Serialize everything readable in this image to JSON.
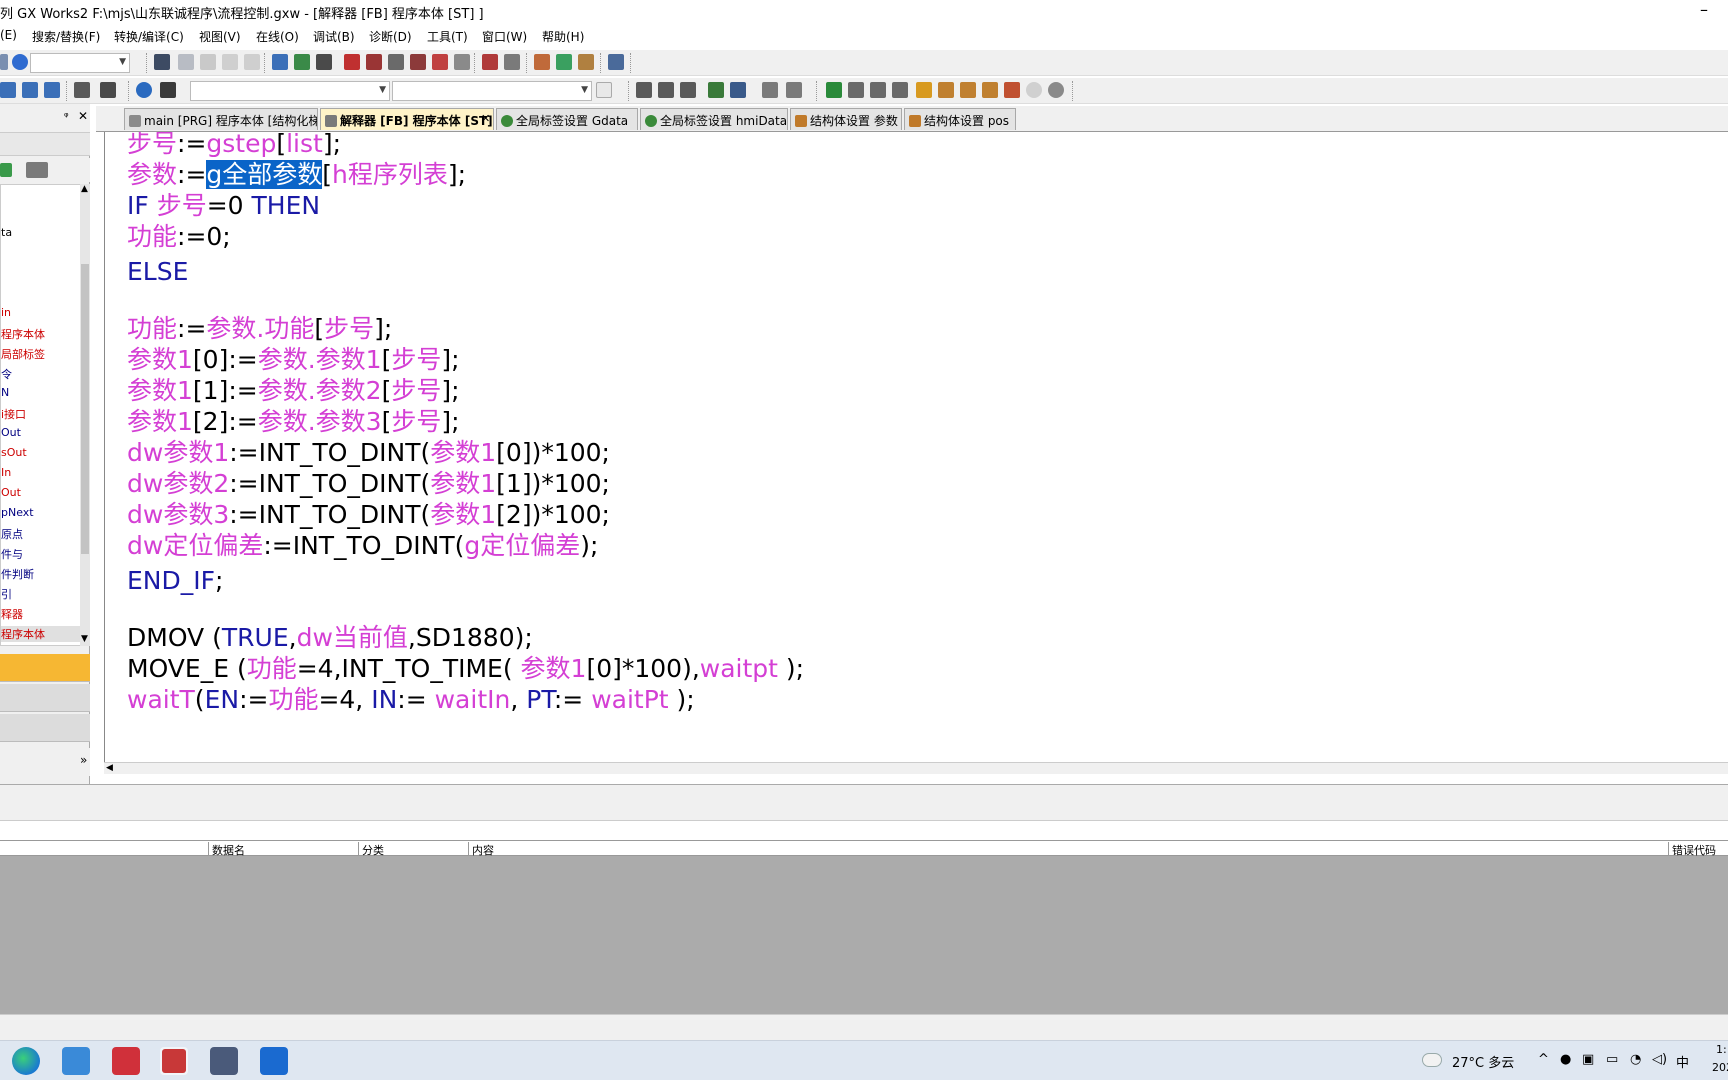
{
  "window": {
    "title": "列 GX Works2 F:\\mjs\\山东联诚程序\\流程控制.gxw - [解释器 [FB] 程序本体 [ST] ]",
    "minimize_glyph": "–"
  },
  "menu": [
    {
      "label": "(E)"
    },
    {
      "label": "搜索/替换(F)"
    },
    {
      "label": "转换/编译(C)"
    },
    {
      "label": "视图(V)"
    },
    {
      "label": "在线(O)"
    },
    {
      "label": "调试(B)"
    },
    {
      "label": "诊断(D)"
    },
    {
      "label": "工具(T)"
    },
    {
      "label": "窗口(W)"
    },
    {
      "label": "帮助(H)"
    }
  ],
  "nav": {
    "pin_glyph": "ᵠ",
    "close_glyph": "✕",
    "tree": [
      {
        "label": "ta",
        "color": "#000000"
      },
      {
        "label": "in",
        "color": "#cc0000"
      },
      {
        "label": "程序本体",
        "color": "#cc0000"
      },
      {
        "label": "局部标签",
        "color": "#cc0000"
      },
      {
        "label": "令",
        "color": "#000080"
      },
      {
        "label": "N",
        "color": "#000080"
      },
      {
        "label": "i接口",
        "color": "#cc0000"
      },
      {
        "label": "Out",
        "color": "#000080"
      },
      {
        "label": "sOut",
        "color": "#cc0000"
      },
      {
        "label": "In",
        "color": "#cc0000"
      },
      {
        "label": "Out",
        "color": "#cc0000"
      },
      {
        "label": "pNext",
        "color": "#000080"
      },
      {
        "label": "原点",
        "color": "#000080"
      },
      {
        "label": "件与",
        "color": "#000080"
      },
      {
        "label": "件判断",
        "color": "#000080"
      },
      {
        "label": "引",
        "color": "#000080"
      },
      {
        "label": "释器",
        "color": "#cc0000"
      },
      {
        "label": "程序本体",
        "color": "#cc0000"
      }
    ],
    "expand_glyph": "»"
  },
  "tabs": [
    {
      "label": "main [PRG] 程序本体 [结构化梯...",
      "active": false
    },
    {
      "label": "解释器 [FB] 程序本体 [ST]",
      "active": true
    },
    {
      "label": "全局标签设置 Gdata",
      "active": false
    },
    {
      "label": "全局标签设置 hmiData",
      "active": false
    },
    {
      "label": "结构体设置 参数",
      "active": false
    },
    {
      "label": "结构体设置 pos",
      "active": false
    }
  ],
  "tab_close_glyph": "✕",
  "code": [
    [
      {
        "t": "步号",
        "c": "var"
      },
      {
        "t": ":=",
        "c": "plain"
      },
      {
        "t": "gstep",
        "c": "var"
      },
      {
        "t": "[",
        "c": "plain"
      },
      {
        "t": "list",
        "c": "var"
      },
      {
        "t": "];",
        "c": "plain"
      }
    ],
    [
      {
        "t": "参数",
        "c": "var"
      },
      {
        "t": ":=",
        "c": "plain"
      },
      {
        "t": "g全部参数",
        "c": "sel"
      },
      {
        "t": "[",
        "c": "plain"
      },
      {
        "t": "h程序列表",
        "c": "var"
      },
      {
        "t": "];",
        "c": "plain"
      }
    ],
    [
      {
        "t": "IF ",
        "c": "kw"
      },
      {
        "t": "步号",
        "c": "var"
      },
      {
        "t": "=0 ",
        "c": "plain"
      },
      {
        "t": "THEN",
        "c": "kw"
      }
    ],
    [
      {
        "t": "   功能",
        "c": "var"
      },
      {
        "t": ":=0;",
        "c": "plain"
      }
    ],
    [
      {
        "t": "ELSE",
        "c": "kw"
      }
    ],
    [],
    [
      {
        "t": "功能",
        "c": "var"
      },
      {
        "t": ":=",
        "c": "plain"
      },
      {
        "t": "参数.功能",
        "c": "var"
      },
      {
        "t": "[",
        "c": "plain"
      },
      {
        "t": "步号",
        "c": "var"
      },
      {
        "t": "];",
        "c": "plain"
      }
    ],
    [
      {
        "t": "参数1",
        "c": "var"
      },
      {
        "t": "[0]:=",
        "c": "plain"
      },
      {
        "t": "参数.参数1",
        "c": "var"
      },
      {
        "t": "[",
        "c": "plain"
      },
      {
        "t": "步号",
        "c": "var"
      },
      {
        "t": "];",
        "c": "plain"
      }
    ],
    [
      {
        "t": "参数1",
        "c": "var"
      },
      {
        "t": "[1]:=",
        "c": "plain"
      },
      {
        "t": "参数.参数2",
        "c": "var"
      },
      {
        "t": "[",
        "c": "plain"
      },
      {
        "t": "步号",
        "c": "var"
      },
      {
        "t": "];",
        "c": "plain"
      }
    ],
    [
      {
        "t": "参数1",
        "c": "var"
      },
      {
        "t": "[2]:=",
        "c": "plain"
      },
      {
        "t": "参数.参数3",
        "c": "var"
      },
      {
        "t": "[",
        "c": "plain"
      },
      {
        "t": "步号",
        "c": "var"
      },
      {
        "t": "];",
        "c": "plain"
      }
    ],
    [
      {
        "t": "dw参数1",
        "c": "var"
      },
      {
        "t": ":=INT_TO_DINT(",
        "c": "plain"
      },
      {
        "t": "参数1",
        "c": "var"
      },
      {
        "t": "[0])*100;",
        "c": "plain"
      }
    ],
    [
      {
        "t": "dw参数2",
        "c": "var"
      },
      {
        "t": ":=INT_TO_DINT(",
        "c": "plain"
      },
      {
        "t": "参数1",
        "c": "var"
      },
      {
        "t": "[1])*100;",
        "c": "plain"
      }
    ],
    [
      {
        "t": "dw参数3",
        "c": "var"
      },
      {
        "t": ":=INT_TO_DINT(",
        "c": "plain"
      },
      {
        "t": "参数1",
        "c": "var"
      },
      {
        "t": "[2])*100;",
        "c": "plain"
      }
    ],
    [
      {
        "t": "dw定位偏差",
        "c": "var"
      },
      {
        "t": ":=INT_TO_DINT(",
        "c": "plain"
      },
      {
        "t": "g定位偏差",
        "c": "var"
      },
      {
        "t": ");",
        "c": "plain"
      }
    ],
    [
      {
        "t": "END_IF",
        "c": "kw"
      },
      {
        "t": ";",
        "c": "plain"
      }
    ],
    [],
    [
      {
        "t": "DMOV (",
        "c": "plain"
      },
      {
        "t": "TRUE",
        "c": "kw"
      },
      {
        "t": ",",
        "c": "plain"
      },
      {
        "t": "dw当前值",
        "c": "var"
      },
      {
        "t": ",SD1880);",
        "c": "plain"
      }
    ],
    [
      {
        "t": "MOVE_E (",
        "c": "plain"
      },
      {
        "t": "功能",
        "c": "var"
      },
      {
        "t": "=4,INT_TO_TIME( ",
        "c": "plain"
      },
      {
        "t": "参数1",
        "c": "var"
      },
      {
        "t": "[0]*100),",
        "c": "plain"
      },
      {
        "t": "waitpt",
        "c": "var"
      },
      {
        "t": " );",
        "c": "plain"
      }
    ],
    [
      {
        "t": "waitT",
        "c": "var"
      },
      {
        "t": "(",
        "c": "plain"
      },
      {
        "t": "EN",
        "c": "kw"
      },
      {
        "t": ":=",
        "c": "plain"
      },
      {
        "t": "功能",
        "c": "var"
      },
      {
        "t": "=4, ",
        "c": "plain"
      },
      {
        "t": "IN",
        "c": "kw"
      },
      {
        "t": ":= ",
        "c": "plain"
      },
      {
        "t": "waitIn",
        "c": "var"
      },
      {
        "t": ", ",
        "c": "plain"
      },
      {
        "t": "PT",
        "c": "kw"
      },
      {
        "t": ":= ",
        "c": "plain"
      },
      {
        "t": "waitPt",
        "c": "var"
      },
      {
        "t": " );",
        "c": "plain"
      }
    ]
  ],
  "output": {
    "columns": [
      "数据名",
      "分类",
      "内容",
      "错误代码"
    ]
  },
  "taskbar": {
    "weather": "27°C 多云",
    "ime": "中",
    "clock_partial_top": "1:",
    "clock_partial_bottom": "202"
  },
  "colors": {
    "keyword": "#1a1aa6",
    "variable": "#d43fd4",
    "selection": "#0a64c8",
    "active_tab": "#fff3c8",
    "nav_orange": "#f6b733"
  }
}
